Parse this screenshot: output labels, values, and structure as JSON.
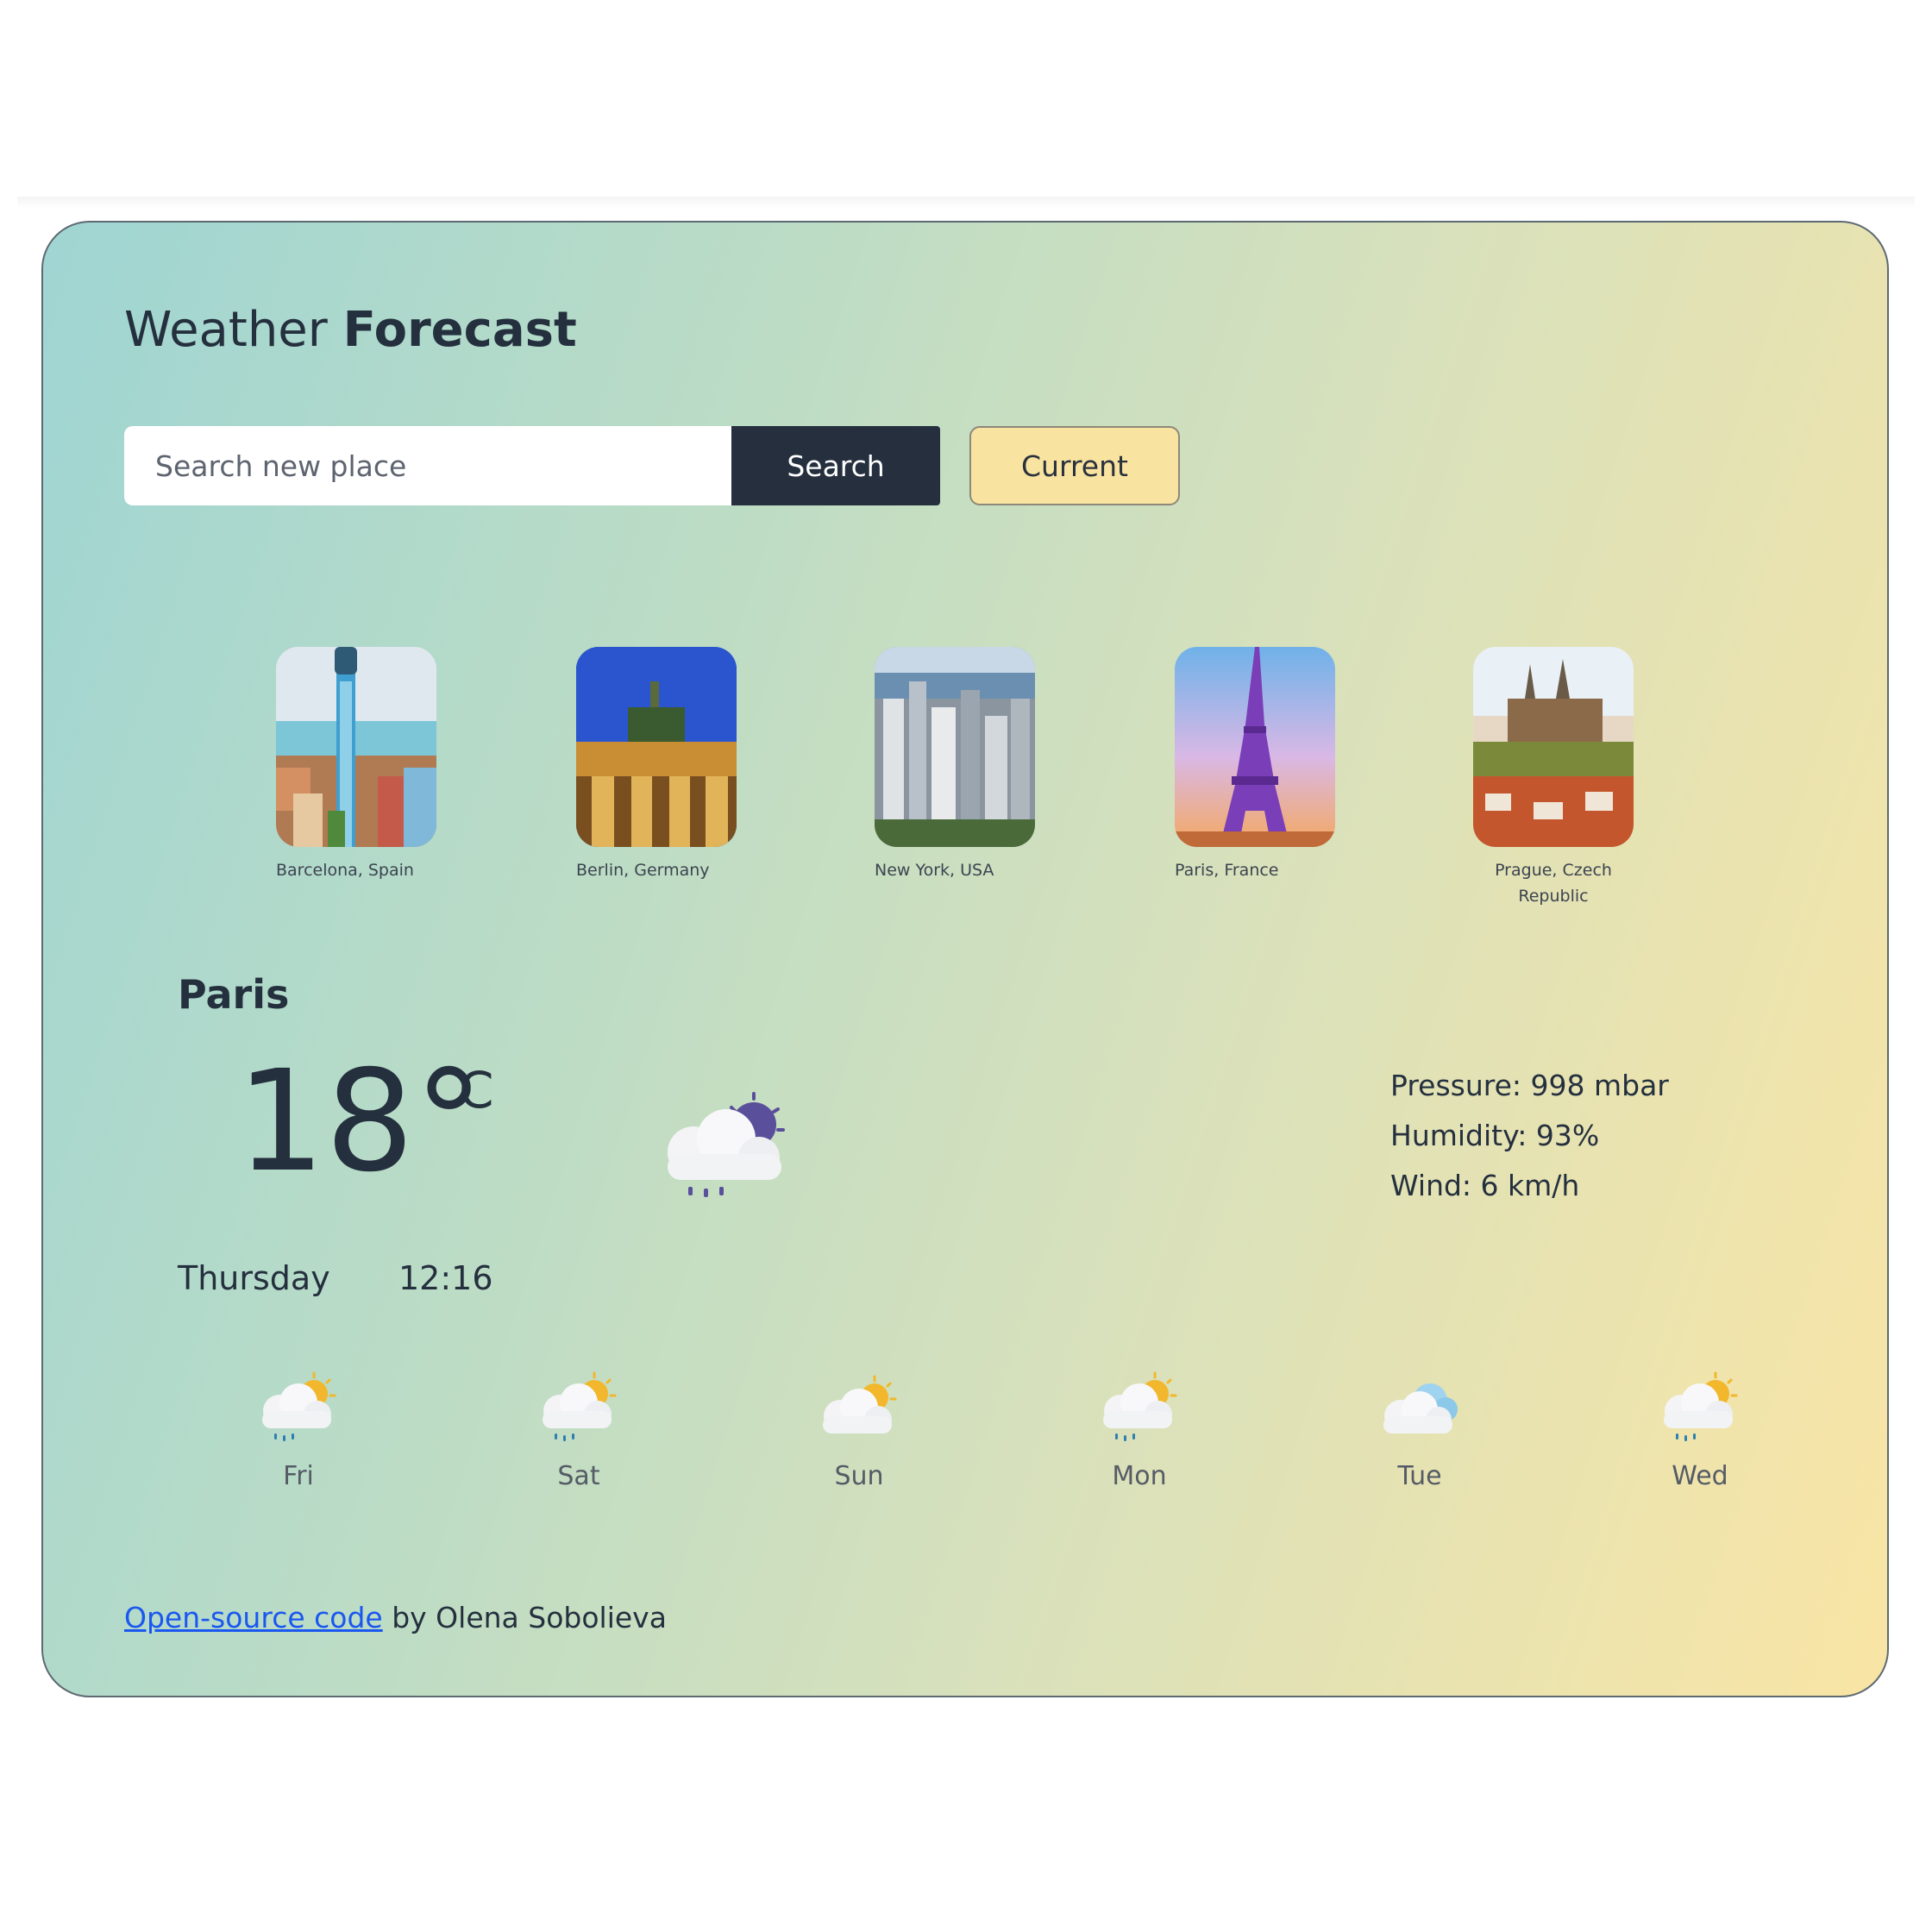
{
  "header": {
    "title_regular": "Weather",
    "title_bold": "Forecast"
  },
  "search": {
    "placeholder": "Search new place",
    "button_label": "Search",
    "current_label": "Current"
  },
  "cities": [
    {
      "name": "Barcelona, Spain",
      "icon": "barcelona-photo"
    },
    {
      "name": "Berlin, Germany",
      "icon": "berlin-photo"
    },
    {
      "name": "New York, USA",
      "icon": "new-york-photo"
    },
    {
      "name": "Paris, France",
      "icon": "paris-photo"
    },
    {
      "name": "Prague, Czech Republic",
      "icon": "prague-photo"
    }
  ],
  "current": {
    "city": "Paris",
    "temperature": "18",
    "degree_symbol": "°",
    "unit": "C",
    "icon": "night-cloud-rain-icon",
    "pressure": "Pressure: 998 mbar",
    "humidity": "Humidity: 93%",
    "wind": "Wind: 6 km/h",
    "day": "Thursday",
    "time": "12:16"
  },
  "forecast": [
    {
      "day": "Fri",
      "icon": "sun-cloud-rain-icon"
    },
    {
      "day": "Sat",
      "icon": "sun-cloud-rain-icon"
    },
    {
      "day": "Sun",
      "icon": "sun-cloud-icon"
    },
    {
      "day": "Mon",
      "icon": "sun-cloud-rain-icon"
    },
    {
      "day": "Tue",
      "icon": "cloudy-icon"
    },
    {
      "day": "Wed",
      "icon": "sun-cloud-rain-icon"
    }
  ],
  "footer": {
    "link_text": "Open-source code",
    "suffix": " by Olena Sobolieva"
  },
  "colors": {
    "gradient_start": "#9fd5d3",
    "gradient_end": "#f9e5a5",
    "search_button": "#252f3e",
    "current_button": "#f9e3a1",
    "link": "#1a57f0"
  }
}
